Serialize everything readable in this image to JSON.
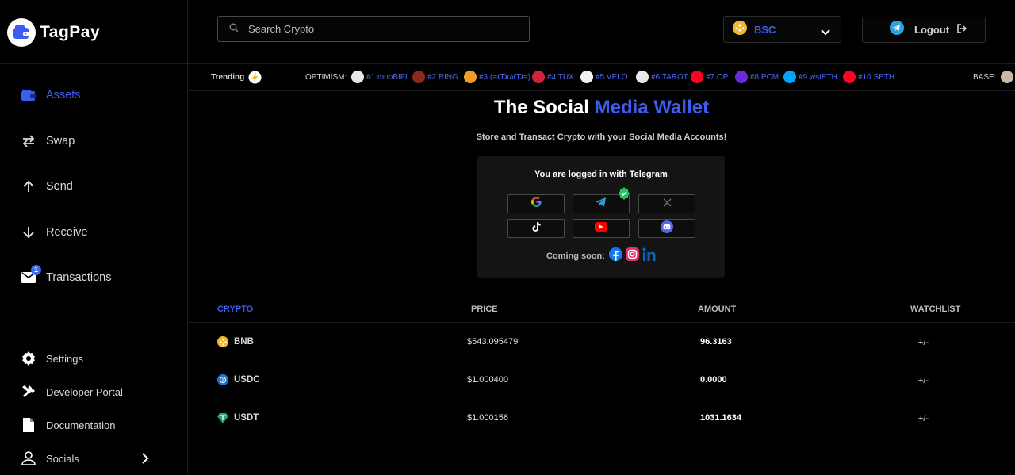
{
  "brand": {
    "part1": "Tag",
    "part2": "Pay"
  },
  "sidebar": {
    "items": [
      {
        "label": "Assets",
        "icon": "wallet-icon"
      },
      {
        "label": "Swap",
        "icon": "swap-arrows-icon"
      },
      {
        "label": "Send",
        "icon": "arrow-up-icon"
      },
      {
        "label": "Receive",
        "icon": "arrow-down-icon"
      },
      {
        "label": "Transactions",
        "icon": "mail-icon",
        "badge": "1"
      }
    ],
    "footer": [
      {
        "label": "Settings",
        "icon": "gear-icon"
      },
      {
        "label": "Developer Portal",
        "icon": "tools-icon"
      },
      {
        "label": "Documentation",
        "icon": "document-icon"
      },
      {
        "label": "Socials",
        "icon": "user-icon"
      }
    ]
  },
  "header": {
    "search_placeholder": "Search Crypto",
    "chain": "BSC",
    "logout": "Logout"
  },
  "trending": {
    "label": "Trending",
    "chain1": "OPTIMISM:",
    "chain2": "BASE:",
    "items": [
      {
        "label": "#1 mooBIFI",
        "color": "#e9e9e9"
      },
      {
        "label": "#2 RING",
        "color": "#8b2a1c"
      },
      {
        "label": "#3 (=ↀωↀ=)",
        "color": "#f0a02a"
      },
      {
        "label": "#4 TUX",
        "color": "#d0223a"
      },
      {
        "label": "#5 VELO",
        "color": "#f2f2f2"
      },
      {
        "label": "#6 TAROT",
        "color": "#e8e8e8"
      },
      {
        "label": "#7 OP",
        "color": "#ff0420"
      },
      {
        "label": "#8 PCM",
        "color": "#6c2bd9"
      },
      {
        "label": "#9 wstETH",
        "color": "#00a3ff"
      },
      {
        "label": "#10 SETH",
        "color": "#ff0420"
      }
    ]
  },
  "hero": {
    "title_plain": "The Social ",
    "title_accent": "Media Wallet",
    "subtitle": "Store and Transact Crypto with your Social Media Accounts!",
    "logged_in": "You are logged in with Telegram",
    "coming_soon": "Coming soon:"
  },
  "table": {
    "headers": [
      "CRYPTO",
      "PRICE",
      "AMOUNT",
      "WATCHLIST"
    ],
    "rows": [
      {
        "symbol": "BNB",
        "price": "$543.095479",
        "amount": "96.3163",
        "watch": "+/-"
      },
      {
        "symbol": "USDC",
        "price": "$1.000400",
        "amount": "0.0000",
        "watch": "+/-"
      },
      {
        "symbol": "USDT",
        "price": "$1.000156",
        "amount": "1031.1634",
        "watch": "+/-"
      }
    ]
  },
  "colors": {
    "accent": "#3d5cf0",
    "background": "#000000",
    "card": "#141414"
  }
}
